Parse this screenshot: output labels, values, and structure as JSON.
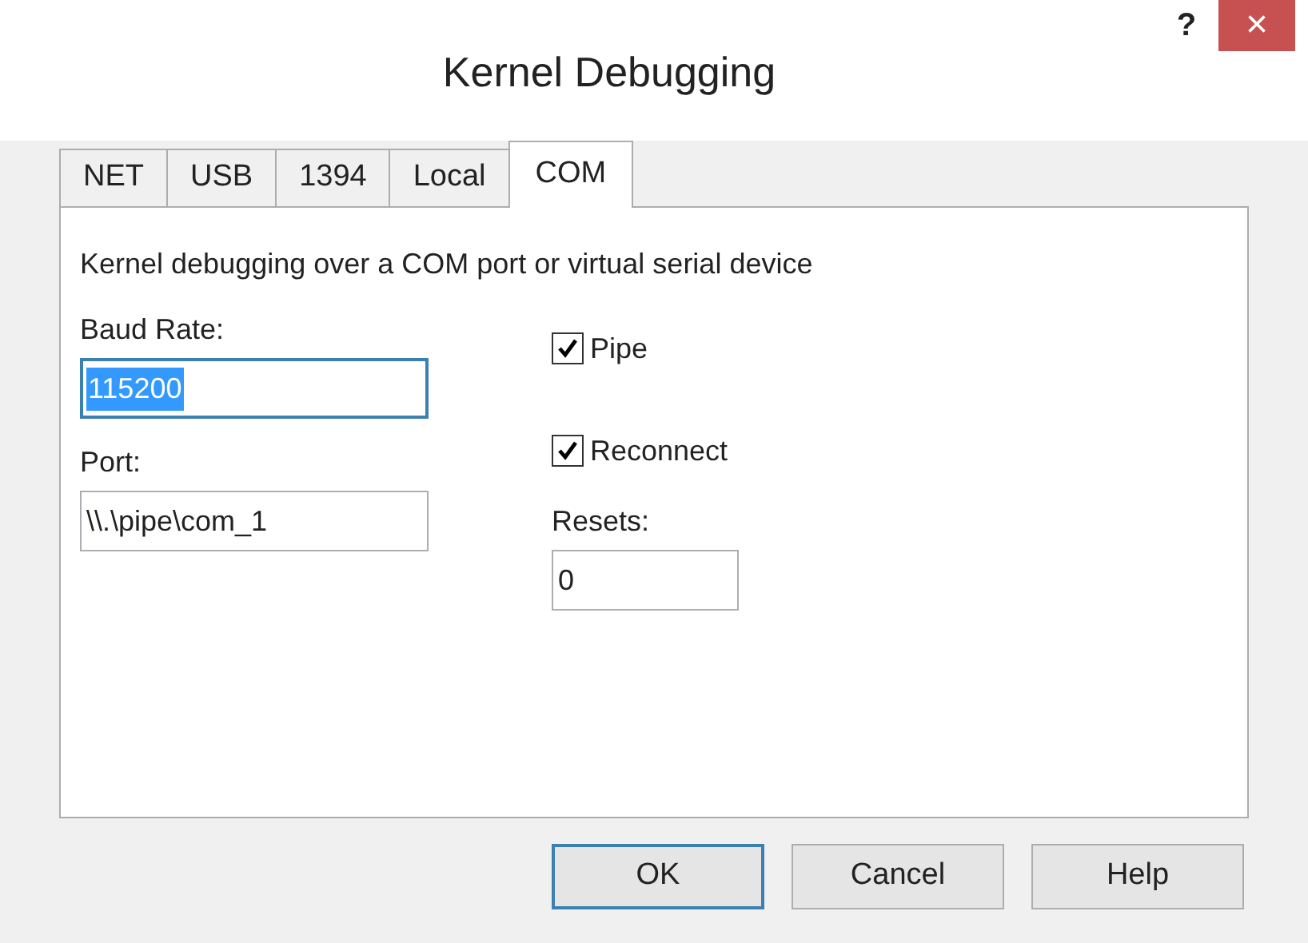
{
  "window": {
    "title": "Kernel Debugging",
    "help": "?",
    "close": "×"
  },
  "tabs": [
    {
      "label": "NET",
      "selected": false
    },
    {
      "label": "USB",
      "selected": false
    },
    {
      "label": "1394",
      "selected": false
    },
    {
      "label": "Local",
      "selected": false
    },
    {
      "label": "COM",
      "selected": true
    }
  ],
  "description": "Kernel debugging over a COM port or virtual serial device",
  "baud_rate": {
    "label": "Baud Rate:",
    "value": "115200",
    "text_selected": true
  },
  "port": {
    "label": "Port:",
    "value": "\\\\.\\pipe\\com_1"
  },
  "pipe": {
    "label": "Pipe",
    "checked": true
  },
  "reconnect": {
    "label": "Reconnect",
    "checked": true
  },
  "resets": {
    "label": "Resets:",
    "value": "0"
  },
  "buttons": [
    {
      "label": "OK",
      "default": true
    },
    {
      "label": "Cancel",
      "default": false
    },
    {
      "label": "Help",
      "default": false
    }
  ]
}
